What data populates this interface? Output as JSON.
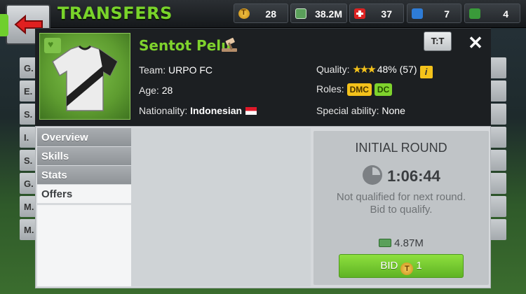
{
  "header": {
    "title": "TRANSFERS",
    "stats": [
      {
        "icon": "token-icon",
        "value": "28"
      },
      {
        "icon": "money-icon",
        "value": "38.2M"
      },
      {
        "icon": "flag-icon",
        "value": "37"
      },
      {
        "icon": "energy-icon",
        "value": "7"
      },
      {
        "icon": "scout-icon",
        "value": "4"
      }
    ]
  },
  "background_list": [
    "G.",
    "E.",
    "S.",
    "I.",
    "S.",
    "G.",
    "M.",
    "M."
  ],
  "player": {
    "name": "Sentot Pelu",
    "team_label": "Team:",
    "team": "URPO FC",
    "age_label": "Age:",
    "age": "28",
    "nationality_label": "Nationality:",
    "nationality": "Indonesian",
    "quality_label": "Quality:",
    "quality": "48% (57)",
    "quality_stars": "★★★",
    "roles_label": "Roles:",
    "roles": [
      "DMC",
      "DC"
    ],
    "special_label": "Special ability:",
    "special": "None"
  },
  "buttons": {
    "compare": "T:T",
    "close": "✕"
  },
  "tabs": [
    "Overview",
    "Skills",
    "Stats",
    "Offers"
  ],
  "auction": {
    "round": "INITIAL ROUND",
    "timer": "1:06:44",
    "note": "Not qualified for next round. Bid to qualify.",
    "price": "4.87M",
    "bid_label": "BID",
    "bid_cost": "1",
    "token_glyph": "T"
  },
  "colors": {
    "accent_green": "#7fd32d",
    "gold": "#f4c21b"
  }
}
